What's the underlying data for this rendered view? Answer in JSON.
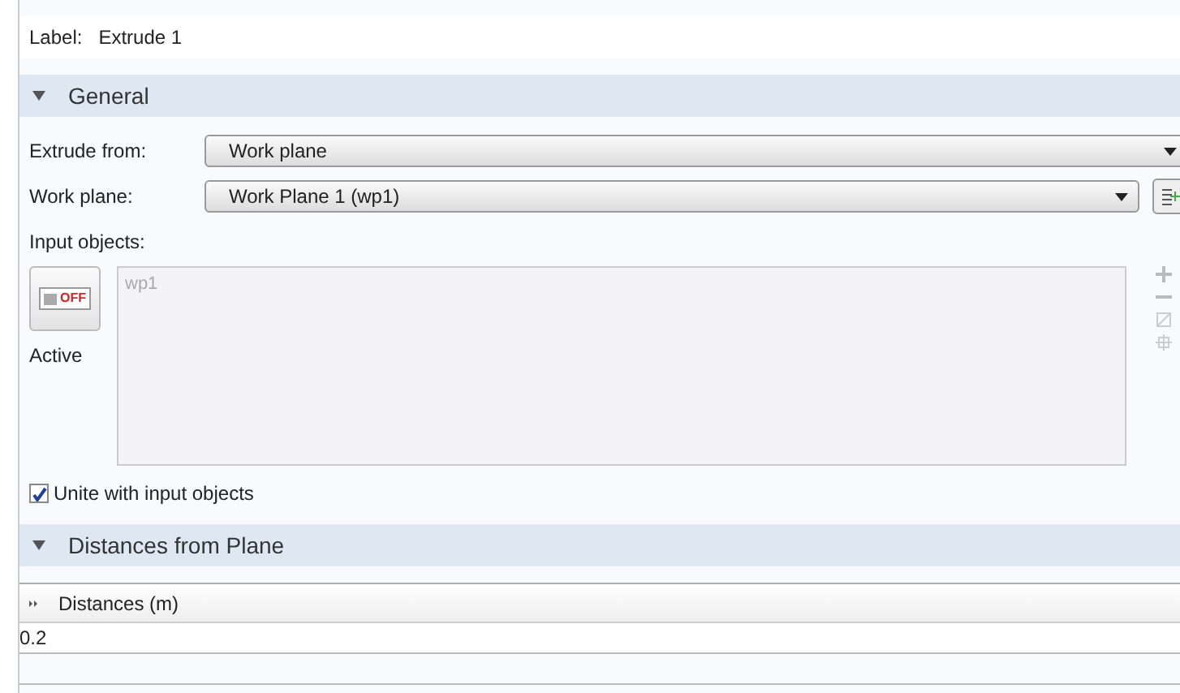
{
  "label": {
    "caption": "Label:",
    "value": "Extrude 1"
  },
  "general": {
    "title": "General",
    "expanded": true,
    "extrude_from": {
      "caption": "Extrude from:",
      "value": "Work plane"
    },
    "work_plane": {
      "caption": "Work plane:",
      "value": "Work Plane 1 (wp1)"
    },
    "input_objects": {
      "caption": "Input objects:",
      "toggle_text": "OFF",
      "on": false,
      "toggle_caption": "Active",
      "items": [
        "wp1"
      ]
    },
    "unite": {
      "label": "Unite with input objects",
      "checked": true
    }
  },
  "distances": {
    "title": "Distances from Plane",
    "expanded": true,
    "table": {
      "header": "Distances (m)",
      "rows": [
        "0.2"
      ]
    }
  }
}
